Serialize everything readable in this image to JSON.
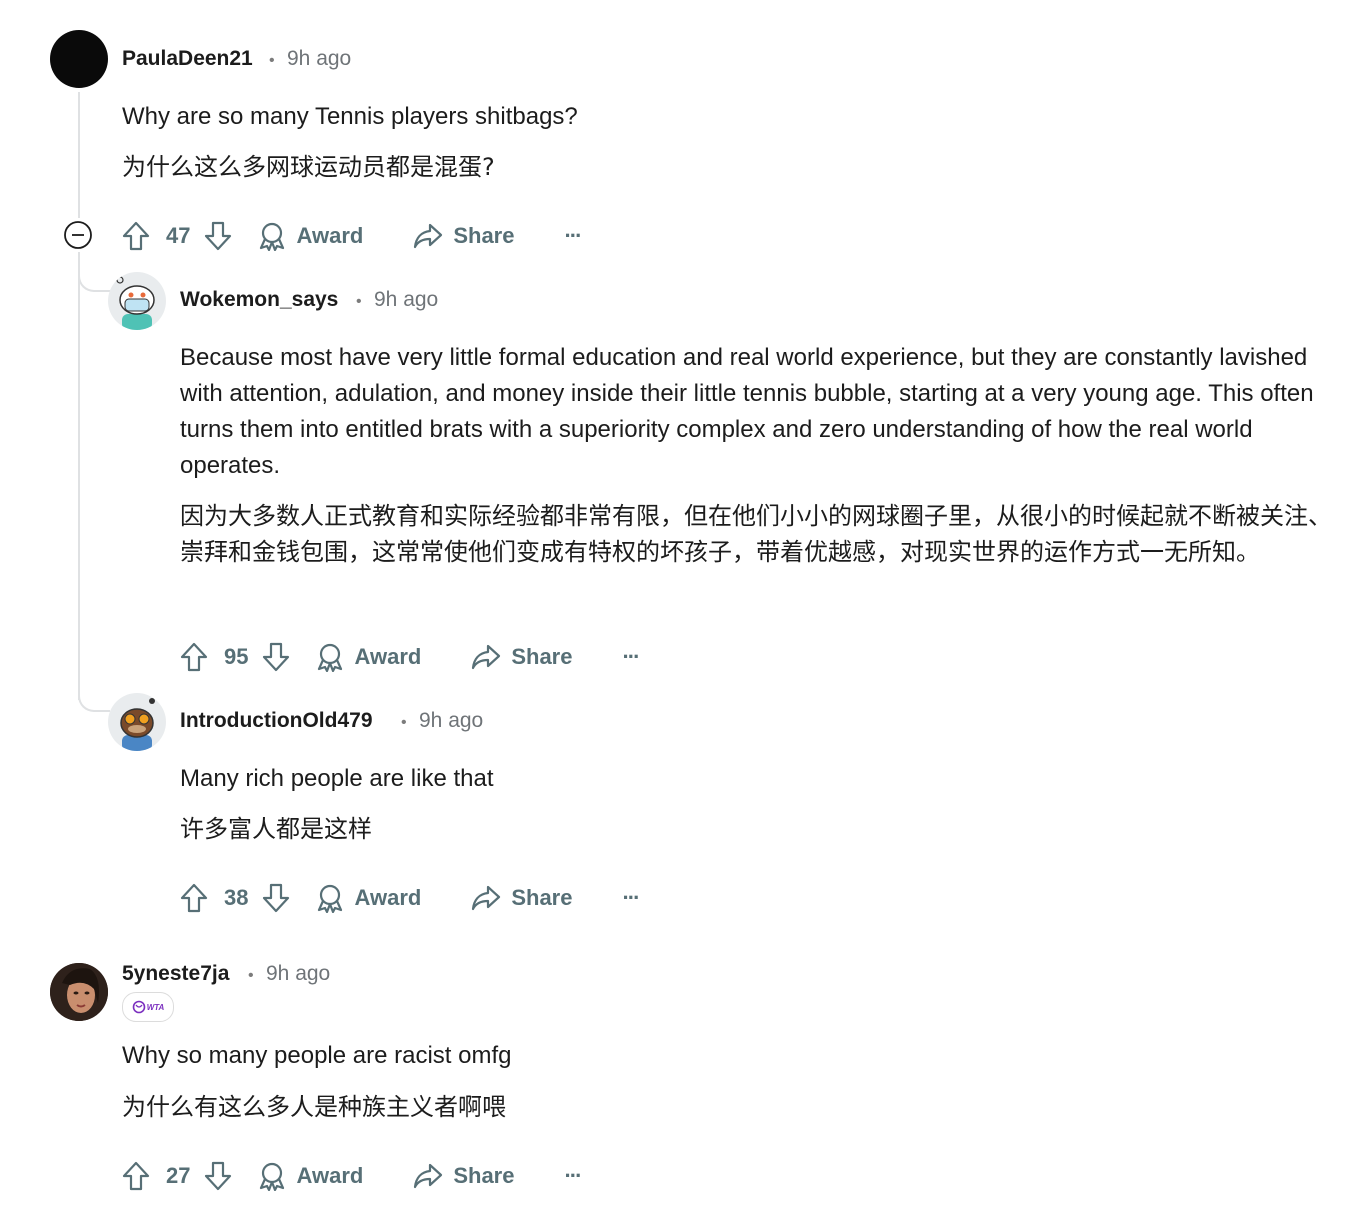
{
  "comments": [
    {
      "username": "PaulaDeen21",
      "separator": "•",
      "time": "9h ago",
      "text_en": "Why are so many Tennis players shitbags?",
      "text_zh": "为什么这么多网球运动员都是混蛋?",
      "votes": "47",
      "award_label": "Award",
      "share_label": "Share",
      "more_label": "···"
    },
    {
      "username": "Wokemon_says",
      "separator": "•",
      "time": "9h ago",
      "text_en": "Because most have very little formal education and real world experience, but they are constantly lavished with attention, adulation, and money inside their little tennis bubble, starting at a very young age. This often turns them into entitled brats with a superiority complex and zero understanding of how the real world operates.",
      "text_zh": "因为大多数人正式教育和实际经验都非常有限，但在他们小小的网球圈子里，从很小的时候起就不断被关注、崇拜和金钱包围，这常常使他们变成有特权的坏孩子，带着优越感，对现实世界的运作方式一无所知。",
      "votes": "95",
      "award_label": "Award",
      "share_label": "Share",
      "more_label": "···"
    },
    {
      "username": "IntroductionOld479",
      "separator": "•",
      "time": "9h ago",
      "text_en": "Many rich people are like that",
      "text_zh": "许多富人都是这样",
      "votes": "38",
      "award_label": "Award",
      "share_label": "Share",
      "more_label": "···"
    },
    {
      "username": "5yneste7ja",
      "separator": "•",
      "time": "9h ago",
      "flair": "WTA",
      "text_en": "Why so many people are racist omfg",
      "text_zh": "为什么有这么多人是种族主义者啊喂",
      "votes": "27",
      "award_label": "Award",
      "share_label": "Share",
      "more_label": "···"
    }
  ],
  "colors": {
    "action_gray": "#576f76",
    "thread_line": "#dfe1e3",
    "flair_purple": "#7b2fbf"
  }
}
